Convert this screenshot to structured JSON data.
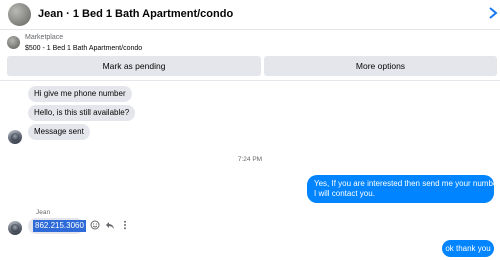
{
  "header": {
    "title": "Jean · 1 Bed 1 Bath Apartment/condo",
    "accent": "#1877f2"
  },
  "marketplace": {
    "label": "Marketplace",
    "listing": "$500 - 1 Bed 1 Bath Apartment/condo"
  },
  "actions": {
    "mark_pending": "Mark as pending",
    "more_options": "More options"
  },
  "messages": {
    "incoming": [
      "Hi give me phone number",
      "Hello, is this still available?",
      "Message sent"
    ],
    "timestamp": "7:24 PM",
    "outgoing_1_line1": "Yes, If you are interested then send me your number",
    "outgoing_1_line2": "I will contact you.",
    "sender_name": "Jean",
    "phone_message": "862.215.3060",
    "outgoing_2": "ok thank you"
  },
  "colors": {
    "outgoing_bubble": "#0084ff",
    "incoming_bubble": "#e4e6eb",
    "selection": "#2f6bd8"
  },
  "icons": [
    "smile-icon",
    "reply-icon",
    "more-dots-icon"
  ]
}
